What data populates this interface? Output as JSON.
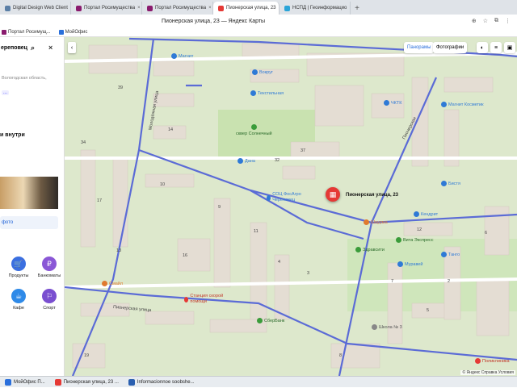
{
  "browser": {
    "tabs": [
      {
        "label": "Digital Design Web Client",
        "color": "#5b7fa6"
      },
      {
        "label": "Портал Росимущества",
        "color": "#8a1b6e"
      },
      {
        "label": "Портал Росимущества",
        "color": "#8a1b6e"
      },
      {
        "label": "Пионерская улица, 23",
        "color": "#e53935"
      },
      {
        "label": "НСПД | Геоинформацио",
        "color": "#2aa4d8"
      }
    ],
    "close_glyph": "×",
    "new_tab_glyph": "+",
    "page_title": "Пионерская улица, 23 — Яндекс Карты",
    "toolbar_icons": [
      "⊕",
      "☆",
      "⧉",
      "⋮"
    ],
    "bookmarks": [
      {
        "label": "Портал Росимущ...",
        "color": "#8a1b6e"
      },
      {
        "label": "МойОфис",
        "color": "#2a6fdb"
      }
    ]
  },
  "panel": {
    "search_value": "ереповец",
    "search_icon": "⌕",
    "clear_icon": "×",
    "address_fragment": "Вологодская область,",
    "more_label": "...",
    "inside_label": "и внутри",
    "photo_button_label": "фото",
    "categories": [
      {
        "label": "Продукты",
        "glyph": "🛒",
        "color": "#3b6fe0"
      },
      {
        "label": "Банкоматы",
        "glyph": "₽",
        "color": "#8a57d6"
      },
      {
        "label": "Кафе",
        "glyph": "☕",
        "color": "#2f8ae8"
      },
      {
        "label": "Спорт",
        "glyph": "⚐",
        "color": "#7a4fd0"
      }
    ]
  },
  "map": {
    "collapse_glyph": "‹",
    "panoramas_label": "Панорамы",
    "photos_label": "Фотографии",
    "map_icons": [
      "◐",
      "≡",
      "▣"
    ],
    "pin_glyph": "▦",
    "pin_label": "Пионерская улица, 23",
    "copyright": "© Яндекс  Справка  Условия",
    "streets": [
      {
        "text": "Молодёжная улица"
      },
      {
        "text": "Пионерская улица"
      },
      {
        "text": "Пионерская"
      }
    ],
    "pois": [
      {
        "label": "Магнит",
        "color": "#2f7ad6"
      },
      {
        "label": "Текстильная",
        "color": "#2f7ad6"
      },
      {
        "label": "ЧКТК",
        "color": "#2f7ad6"
      },
      {
        "label": "Магнит Косметик",
        "color": "#2f7ad6"
      },
      {
        "label": "сквер Солнечный",
        "color": "#3a9c3a"
      },
      {
        "label": "Дана",
        "color": "#2f7ad6"
      },
      {
        "label": "СОЦ ФосАгро Череповец",
        "color": "#2f7ad6"
      },
      {
        "label": "Шаурма",
        "color": "#e07a2f"
      },
      {
        "label": "Вита Экспресс",
        "color": "#3a9c3a"
      },
      {
        "label": "Здравсити",
        "color": "#3a9c3a"
      },
      {
        "label": "Кендрит",
        "color": "#2f7ad6"
      },
      {
        "label": "Танго",
        "color": "#2f7ad6"
      },
      {
        "label": "Муравей",
        "color": "#2f7ad6"
      },
      {
        "label": "Бистя",
        "color": "#2f7ad6"
      },
      {
        "label": "Смайл",
        "color": "#e07a2f"
      },
      {
        "label": "Станция скорой помощи",
        "color": "#e53935"
      },
      {
        "label": "СберБанк",
        "color": "#3a9c3a"
      },
      {
        "label": "Школа № 3",
        "color": "#888888"
      },
      {
        "label": "Поликлиника",
        "color": "#e53935"
      },
      {
        "label": "Вокруг",
        "color": "#2f7ad6"
      }
    ],
    "numbers": [
      "39",
      "14",
      "32",
      "37",
      "9",
      "34",
      "13",
      "11",
      "3",
      "4",
      "12",
      "7",
      "2",
      "6",
      "5",
      "8",
      "10",
      "17",
      "19",
      "16"
    ]
  },
  "taskbar": [
    {
      "label": "МойОфис П...",
      "color": "#2a6fdb"
    },
    {
      "label": "Пионерская улица, 23 ...",
      "color": "#e53935"
    },
    {
      "label": "Informacionnoe soobshe...",
      "color": "#2a5fb0"
    }
  ]
}
